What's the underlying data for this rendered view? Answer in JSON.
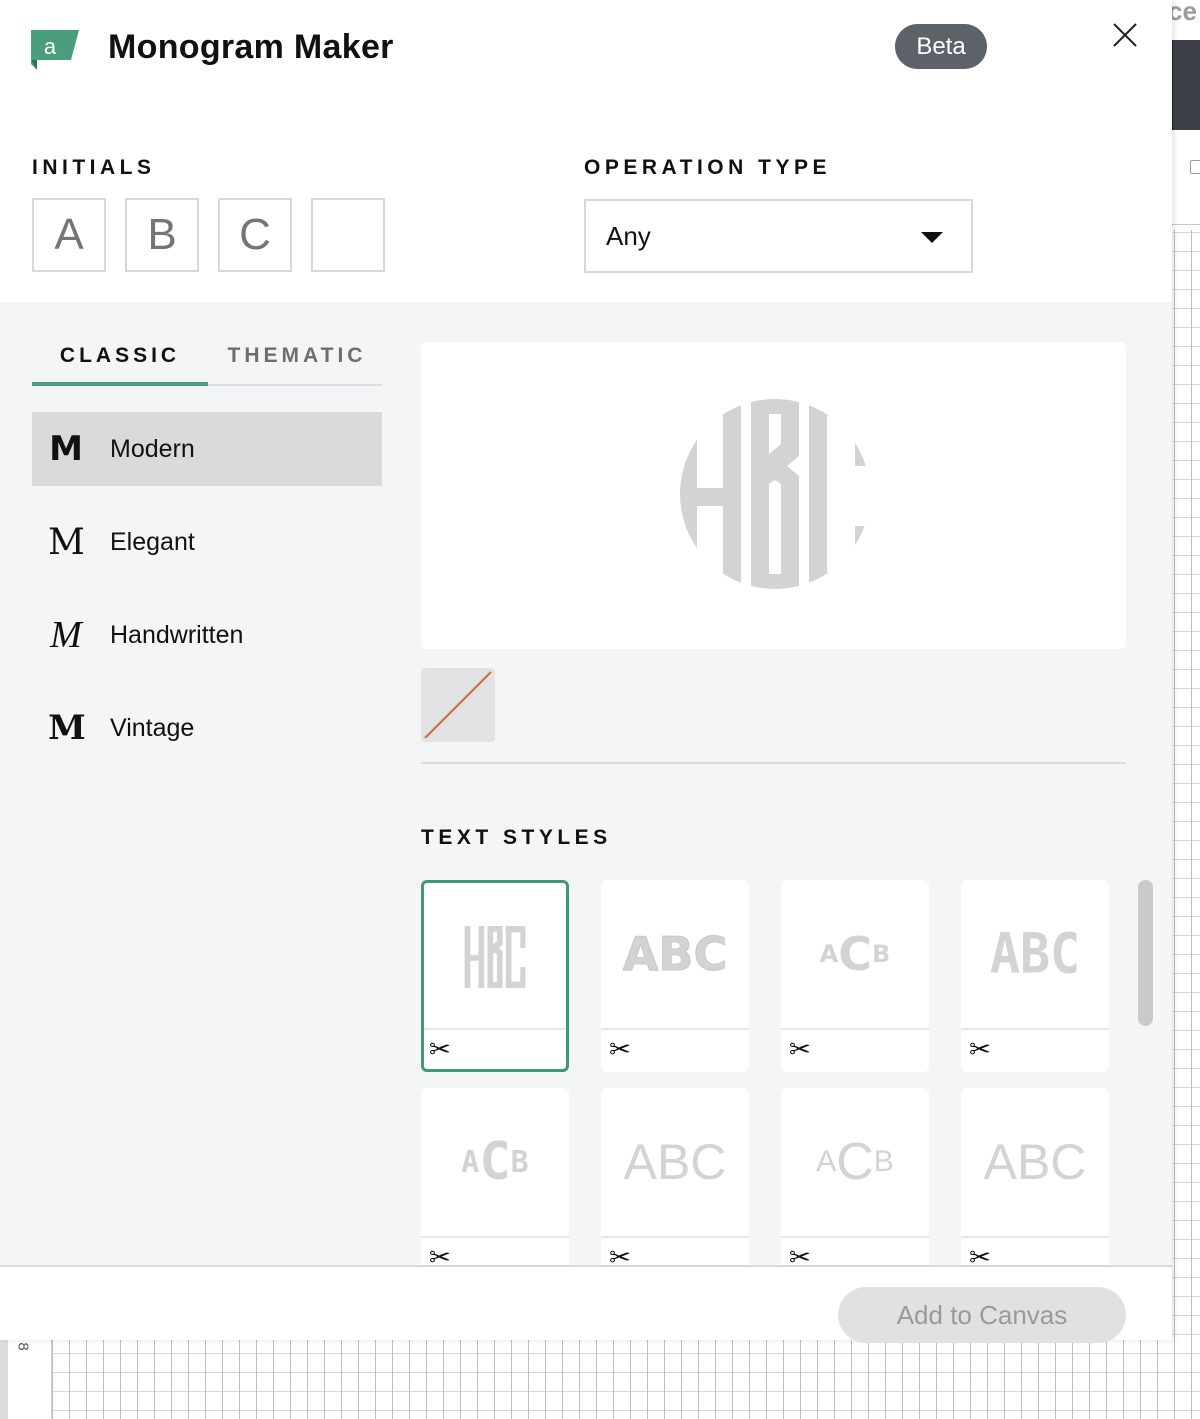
{
  "app": {
    "title": "Monogram Maker",
    "badge": "Beta",
    "logo_icon": "app-logo-a-icon",
    "close_icon": "close-icon",
    "brand_color": "#4a9e7c"
  },
  "initials": {
    "label": "INITIALS",
    "fields": [
      {
        "placeholder": "A",
        "value": ""
      },
      {
        "placeholder": "B",
        "value": ""
      },
      {
        "placeholder": "C",
        "value": ""
      },
      {
        "placeholder": "",
        "value": ""
      }
    ]
  },
  "operation_type": {
    "label": "OPERATION TYPE",
    "selected": "Any",
    "icon": "caret-down-icon"
  },
  "tabs": [
    {
      "label": "CLASSIC",
      "active": true
    },
    {
      "label": "THEMATIC",
      "active": false
    }
  ],
  "styles": [
    {
      "glyph": "M",
      "label": "Modern",
      "selected": true
    },
    {
      "glyph": "M",
      "label": "Elegant",
      "selected": false
    },
    {
      "glyph": "M",
      "label": "Handwritten",
      "selected": false
    },
    {
      "glyph": "M",
      "label": "Vintage",
      "selected": false
    }
  ],
  "preview": {
    "text": "ABC",
    "color_swatch": "none"
  },
  "text_styles": {
    "label": "TEXT STYLES",
    "cards": [
      {
        "sample": "ABC",
        "style": "circle-monogram",
        "selected": true,
        "icon": "scissors-icon"
      },
      {
        "sample": "ABC",
        "style": "inline-bold",
        "selected": false,
        "icon": "scissors-icon"
      },
      {
        "sample": "ACB",
        "style": "inline-stacked",
        "selected": false,
        "icon": "scissors-icon"
      },
      {
        "sample": "ABC",
        "style": "varsity",
        "selected": false,
        "icon": "scissors-icon"
      },
      {
        "sample": "ACB",
        "style": "varsity-stacked",
        "selected": false,
        "icon": "scissors-icon"
      },
      {
        "sample": "ABC",
        "style": "sans-light",
        "selected": false,
        "icon": "scissors-icon"
      },
      {
        "sample": "ACB",
        "style": "sans-light-stacked",
        "selected": false,
        "icon": "scissors-icon"
      },
      {
        "sample": "ABC",
        "style": "sans-thin",
        "selected": false,
        "icon": "scissors-icon"
      }
    ]
  },
  "footer": {
    "add_button": "Add to Canvas"
  },
  "background": {
    "right_label": "ce",
    "ruler_number": "8"
  }
}
